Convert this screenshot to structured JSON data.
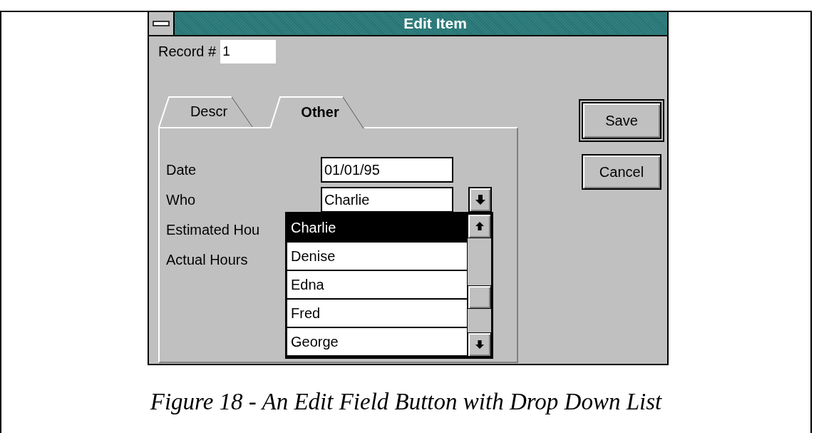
{
  "window": {
    "title": "Edit Item"
  },
  "record": {
    "label": "Record #",
    "value": "1"
  },
  "tabs": [
    {
      "label": "Descr",
      "selected": false
    },
    {
      "label": "Other",
      "selected": true
    }
  ],
  "fields": [
    {
      "label": "Date",
      "kind": "text",
      "value": "01/01/95"
    },
    {
      "label": "Who",
      "kind": "dropdown",
      "value": "Charlie"
    },
    {
      "label": "Estimated Hou",
      "kind": "label"
    },
    {
      "label": "Actual Hours",
      "kind": "label"
    }
  ],
  "dropdown_list": {
    "items": [
      {
        "label": "Charlie",
        "selected": true
      },
      {
        "label": "Denise",
        "selected": false
      },
      {
        "label": "Edna",
        "selected": false
      },
      {
        "label": "Fred",
        "selected": false
      },
      {
        "label": "George",
        "selected": false
      }
    ]
  },
  "buttons": [
    {
      "label": "Save",
      "default": true
    },
    {
      "label": "Cancel",
      "default": false
    }
  ],
  "caption": "Figure 18 - An Edit Field Button with Drop Down List"
}
